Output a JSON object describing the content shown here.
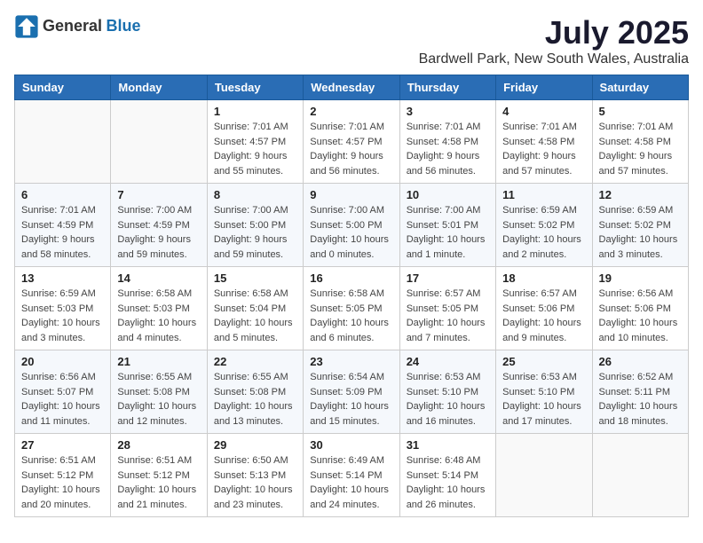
{
  "header": {
    "logo": {
      "general": "General",
      "blue": "Blue"
    },
    "title": "July 2025",
    "location": "Bardwell Park, New South Wales, Australia"
  },
  "calendar": {
    "days_of_week": [
      "Sunday",
      "Monday",
      "Tuesday",
      "Wednesday",
      "Thursday",
      "Friday",
      "Saturday"
    ],
    "weeks": [
      [
        {
          "day": "",
          "info": ""
        },
        {
          "day": "",
          "info": ""
        },
        {
          "day": "1",
          "info": "Sunrise: 7:01 AM\nSunset: 4:57 PM\nDaylight: 9 hours and 55 minutes."
        },
        {
          "day": "2",
          "info": "Sunrise: 7:01 AM\nSunset: 4:57 PM\nDaylight: 9 hours and 56 minutes."
        },
        {
          "day": "3",
          "info": "Sunrise: 7:01 AM\nSunset: 4:58 PM\nDaylight: 9 hours and 56 minutes."
        },
        {
          "day": "4",
          "info": "Sunrise: 7:01 AM\nSunset: 4:58 PM\nDaylight: 9 hours and 57 minutes."
        },
        {
          "day": "5",
          "info": "Sunrise: 7:01 AM\nSunset: 4:58 PM\nDaylight: 9 hours and 57 minutes."
        }
      ],
      [
        {
          "day": "6",
          "info": "Sunrise: 7:01 AM\nSunset: 4:59 PM\nDaylight: 9 hours and 58 minutes."
        },
        {
          "day": "7",
          "info": "Sunrise: 7:00 AM\nSunset: 4:59 PM\nDaylight: 9 hours and 59 minutes."
        },
        {
          "day": "8",
          "info": "Sunrise: 7:00 AM\nSunset: 5:00 PM\nDaylight: 9 hours and 59 minutes."
        },
        {
          "day": "9",
          "info": "Sunrise: 7:00 AM\nSunset: 5:00 PM\nDaylight: 10 hours and 0 minutes."
        },
        {
          "day": "10",
          "info": "Sunrise: 7:00 AM\nSunset: 5:01 PM\nDaylight: 10 hours and 1 minute."
        },
        {
          "day": "11",
          "info": "Sunrise: 6:59 AM\nSunset: 5:02 PM\nDaylight: 10 hours and 2 minutes."
        },
        {
          "day": "12",
          "info": "Sunrise: 6:59 AM\nSunset: 5:02 PM\nDaylight: 10 hours and 3 minutes."
        }
      ],
      [
        {
          "day": "13",
          "info": "Sunrise: 6:59 AM\nSunset: 5:03 PM\nDaylight: 10 hours and 3 minutes."
        },
        {
          "day": "14",
          "info": "Sunrise: 6:58 AM\nSunset: 5:03 PM\nDaylight: 10 hours and 4 minutes."
        },
        {
          "day": "15",
          "info": "Sunrise: 6:58 AM\nSunset: 5:04 PM\nDaylight: 10 hours and 5 minutes."
        },
        {
          "day": "16",
          "info": "Sunrise: 6:58 AM\nSunset: 5:05 PM\nDaylight: 10 hours and 6 minutes."
        },
        {
          "day": "17",
          "info": "Sunrise: 6:57 AM\nSunset: 5:05 PM\nDaylight: 10 hours and 7 minutes."
        },
        {
          "day": "18",
          "info": "Sunrise: 6:57 AM\nSunset: 5:06 PM\nDaylight: 10 hours and 9 minutes."
        },
        {
          "day": "19",
          "info": "Sunrise: 6:56 AM\nSunset: 5:06 PM\nDaylight: 10 hours and 10 minutes."
        }
      ],
      [
        {
          "day": "20",
          "info": "Sunrise: 6:56 AM\nSunset: 5:07 PM\nDaylight: 10 hours and 11 minutes."
        },
        {
          "day": "21",
          "info": "Sunrise: 6:55 AM\nSunset: 5:08 PM\nDaylight: 10 hours and 12 minutes."
        },
        {
          "day": "22",
          "info": "Sunrise: 6:55 AM\nSunset: 5:08 PM\nDaylight: 10 hours and 13 minutes."
        },
        {
          "day": "23",
          "info": "Sunrise: 6:54 AM\nSunset: 5:09 PM\nDaylight: 10 hours and 15 minutes."
        },
        {
          "day": "24",
          "info": "Sunrise: 6:53 AM\nSunset: 5:10 PM\nDaylight: 10 hours and 16 minutes."
        },
        {
          "day": "25",
          "info": "Sunrise: 6:53 AM\nSunset: 5:10 PM\nDaylight: 10 hours and 17 minutes."
        },
        {
          "day": "26",
          "info": "Sunrise: 6:52 AM\nSunset: 5:11 PM\nDaylight: 10 hours and 18 minutes."
        }
      ],
      [
        {
          "day": "27",
          "info": "Sunrise: 6:51 AM\nSunset: 5:12 PM\nDaylight: 10 hours and 20 minutes."
        },
        {
          "day": "28",
          "info": "Sunrise: 6:51 AM\nSunset: 5:12 PM\nDaylight: 10 hours and 21 minutes."
        },
        {
          "day": "29",
          "info": "Sunrise: 6:50 AM\nSunset: 5:13 PM\nDaylight: 10 hours and 23 minutes."
        },
        {
          "day": "30",
          "info": "Sunrise: 6:49 AM\nSunset: 5:14 PM\nDaylight: 10 hours and 24 minutes."
        },
        {
          "day": "31",
          "info": "Sunrise: 6:48 AM\nSunset: 5:14 PM\nDaylight: 10 hours and 26 minutes."
        },
        {
          "day": "",
          "info": ""
        },
        {
          "day": "",
          "info": ""
        }
      ]
    ]
  }
}
